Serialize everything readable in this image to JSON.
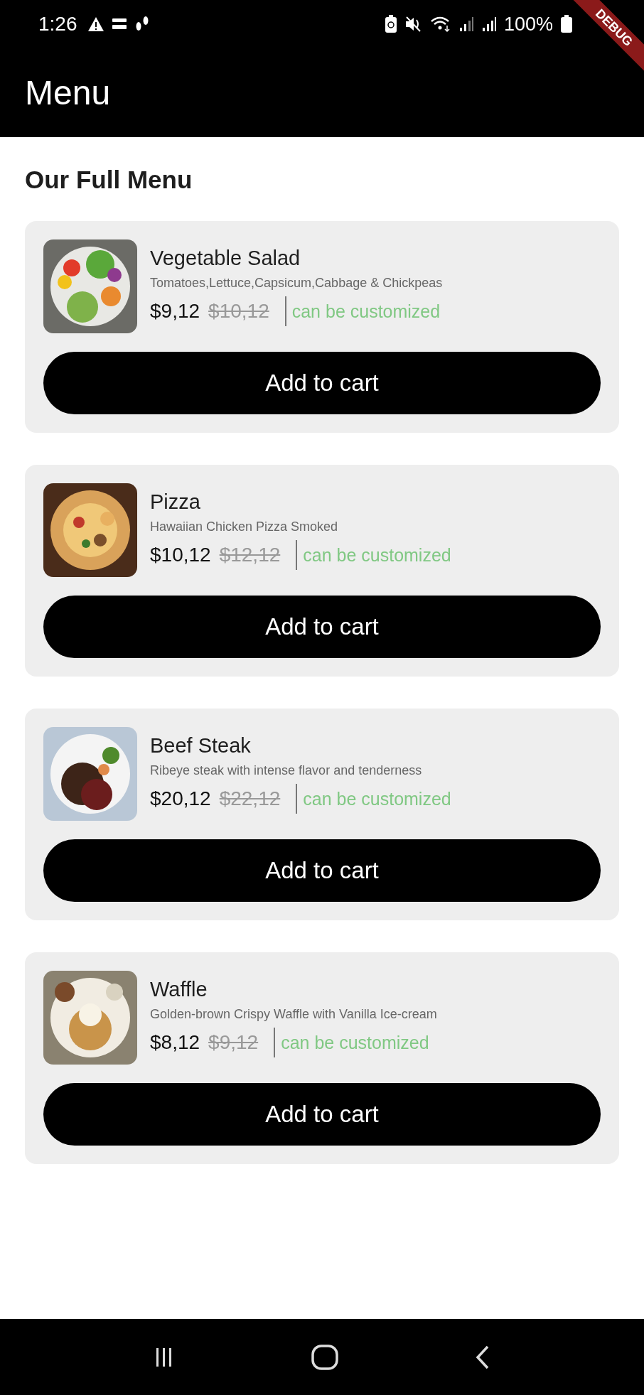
{
  "status_bar": {
    "time": "1:26",
    "battery": "100%"
  },
  "debug_banner": "DEBUG",
  "app_bar": {
    "title": "Menu"
  },
  "heading": "Our Full Menu",
  "items": [
    {
      "name": "Vegetable Salad",
      "description": "Tomatoes,Lettuce,Capsicum,Cabbage & Chickpeas",
      "price": "$9,12",
      "old_price": "$10,12",
      "note": "can be customized",
      "button": "Add to cart"
    },
    {
      "name": "Pizza",
      "description": "Hawaiian Chicken Pizza Smoked",
      "price": "$10,12",
      "old_price": "$12,12",
      "note": "can be customized",
      "button": "Add to cart"
    },
    {
      "name": "Beef Steak",
      "description": "Ribeye steak with intense flavor and tenderness",
      "price": "$20,12",
      "old_price": "$22,12",
      "note": "can be customized",
      "button": "Add to cart"
    },
    {
      "name": "Waffle",
      "description": "Golden-brown Crispy Waffle with Vanilla Ice-cream",
      "price": "$8,12",
      "old_price": "$9,12",
      "note": "can be customized",
      "button": "Add to cart"
    }
  ]
}
